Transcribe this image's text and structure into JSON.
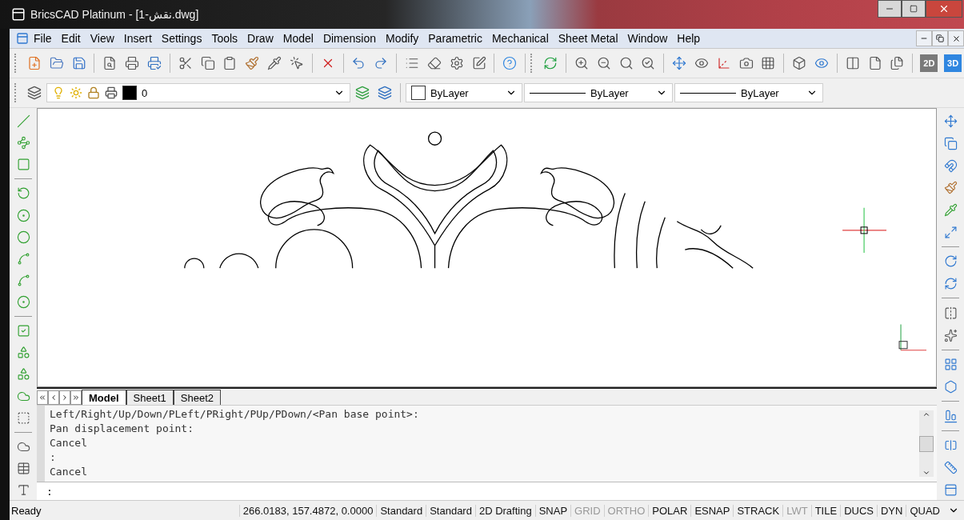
{
  "window": {
    "title": "BricsCAD Platinum - [1-نقش.dwg]"
  },
  "menu": [
    "File",
    "Edit",
    "View",
    "Insert",
    "Settings",
    "Tools",
    "Draw",
    "Model",
    "Dimension",
    "Modify",
    "Parametric",
    "Mechanical",
    "Sheet Metal",
    "Window",
    "Help"
  ],
  "view_buttons": [
    {
      "label": "2D",
      "selected": false
    },
    {
      "label": "3D",
      "selected": true
    }
  ],
  "layer_toolbar": {
    "layer": "0",
    "color_setting": "ByLayer",
    "linetype": "ByLayer",
    "lineweight": "ByLayer"
  },
  "tabs": [
    {
      "label": "Model",
      "selected": true
    },
    {
      "label": "Sheet1",
      "selected": false
    },
    {
      "label": "Sheet2",
      "selected": false
    }
  ],
  "command_history": [
    "Left/Right/Up/Down/PLeft/PRight/PUp/PDown/<Pan base point>:",
    "Pan displacement point:",
    "Cancel",
    ":",
    "Cancel"
  ],
  "command_prompt": ":",
  "status_bar": {
    "message": "Ready",
    "fields": [
      {
        "kind": "info",
        "label": "266.0183, 157.4872, 0.0000"
      },
      {
        "kind": "info",
        "label": "Standard"
      },
      {
        "kind": "info",
        "label": "Standard"
      },
      {
        "kind": "info",
        "label": "2D Drafting"
      },
      {
        "kind": "toggle",
        "label": "SNAP",
        "on": true
      },
      {
        "kind": "toggle",
        "label": "GRID",
        "on": false
      },
      {
        "kind": "toggle",
        "label": "ORTHO",
        "on": false
      },
      {
        "kind": "toggle",
        "label": "POLAR",
        "on": true
      },
      {
        "kind": "toggle",
        "label": "ESNAP",
        "on": true
      },
      {
        "kind": "toggle",
        "label": "STRACK",
        "on": true
      },
      {
        "kind": "toggle",
        "label": "LWT",
        "on": false
      },
      {
        "kind": "toggle",
        "label": "TILE",
        "on": true
      },
      {
        "kind": "toggle",
        "label": "DUCS",
        "on": true
      },
      {
        "kind": "toggle",
        "label": "DYN",
        "on": true
      },
      {
        "kind": "toggle",
        "label": "QUAD",
        "on": true
      }
    ]
  }
}
